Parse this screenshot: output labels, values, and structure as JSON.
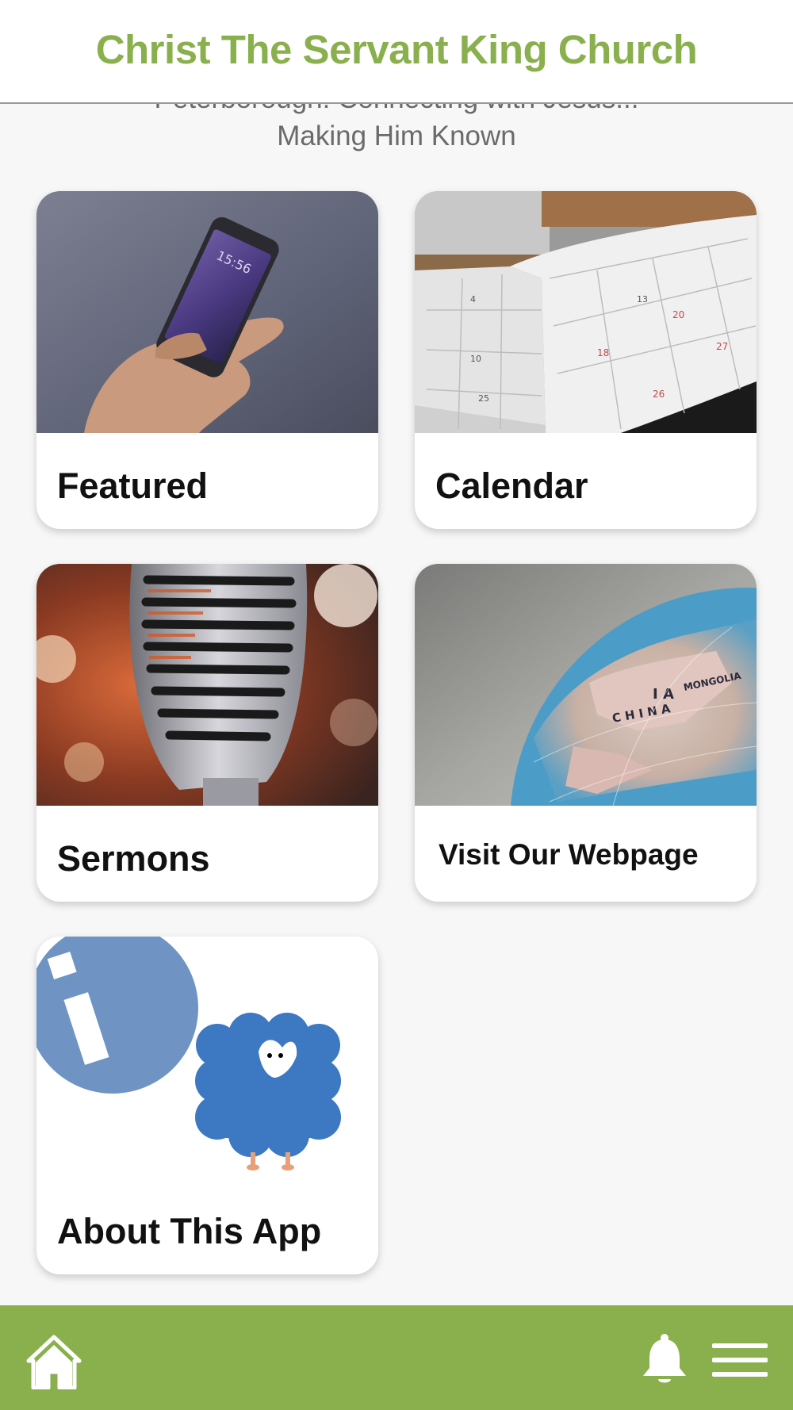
{
  "header": {
    "title": "Christ The Servant King Church"
  },
  "tagline": {
    "line1": "Peterborough: Connecting with Jesus...",
    "line2": "Making Him Known"
  },
  "tiles": [
    {
      "label": "Featured",
      "image": "hand-holding-phone"
    },
    {
      "label": "Calendar",
      "image": "open-calendar-book"
    },
    {
      "label": "Sermons",
      "image": "vintage-microphone"
    },
    {
      "label": "Visit Our Webpage",
      "image": "globe"
    },
    {
      "label": "About This App",
      "image": "info-sheep-illustration"
    }
  ],
  "bottom_nav": {
    "left": [
      "home-icon"
    ],
    "right": [
      "bell-icon",
      "hamburger-menu-icon"
    ]
  },
  "colors": {
    "brand_green": "#8ab04e",
    "background": "#f7f7f7",
    "card": "#ffffff",
    "info_blue": "#6f94c4",
    "sheep_blue": "#3d78c2"
  }
}
